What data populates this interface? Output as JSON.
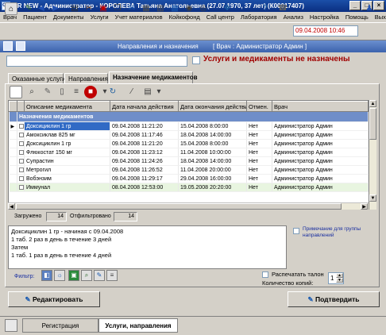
{
  "window": {
    "title": "CR NEW - Администратор - КОРОЛЕВА Татьяна Анатольевна (27.07.1970, 37 лет) (К00017407)",
    "app_icon": "CR",
    "buttons": [
      "_",
      "□",
      "×"
    ]
  },
  "menu": [
    "Врач",
    "Пациент",
    "Документы",
    "Услуги",
    "Учет материалов",
    "Койкофонд",
    "Call центр",
    "Лаборатория",
    "Анализ",
    "Настройка",
    "Помощь",
    "Выход"
  ],
  "toolbar": {
    "datetime": "09.04.2008 10:46"
  },
  "header": {
    "title": "Направления и назначения",
    "doctor": "[ Врач : Администратор Админ ]",
    "warning": "Услуги и медикаменты не назначены"
  },
  "tabs": [
    "Оказанные услуги",
    "Направления",
    "Назначение медикаментов"
  ],
  "grid": {
    "columns": [
      "Описание медикамента",
      "Дата начала действия",
      "Дата окончания действия",
      "Отмен.",
      "Врач"
    ],
    "group": "Назначения медикаментов",
    "rows": [
      {
        "name": "Доксициклин 1 гр",
        "start": "09.04.2008 11:21:20",
        "end": "15.04.2008 8:00:00",
        "cancel": "Нет",
        "doctor": "Администратор Админ"
      },
      {
        "name": "Амоксиклав 825 мг",
        "start": "09.04.2008 11:17:46",
        "end": "18.04.2008 14:00:00",
        "cancel": "Нет",
        "doctor": "Администратор Админ"
      },
      {
        "name": "Доксициклин 1 гр",
        "start": "09.04.2008 11:21:20",
        "end": "15.04.2008 8:00:00",
        "cancel": "Нет",
        "doctor": "Администратор Админ"
      },
      {
        "name": "Флюкостат 150 мг",
        "start": "09.04.2008 11:23:12",
        "end": "11.04.2008 10:00:00",
        "cancel": "Нет",
        "doctor": "Администратор Админ"
      },
      {
        "name": "Супрастин",
        "start": "09.04.2008 11:24:26",
        "end": "18.04.2008 14:00:00",
        "cancel": "Нет",
        "doctor": "Администратор Админ"
      },
      {
        "name": "Метрогил",
        "start": "09.04.2008 11:26:52",
        "end": "11.04.2008 20:00:00",
        "cancel": "Нет",
        "doctor": "Администратор Админ"
      },
      {
        "name": "Вобэнзим",
        "start": "09.04.2008 11:29:17",
        "end": "29.04.2008 16:00:00",
        "cancel": "Нет",
        "doctor": "Администратор Админ"
      },
      {
        "name": "Иммунал",
        "start": "08.04.2008 12:53:00",
        "end": "19.05.2008 20:20:00",
        "cancel": "Нет",
        "doctor": "Администратор Админ"
      }
    ]
  },
  "counts": {
    "loaded_label": "Загружено",
    "loaded": "14",
    "filtered_label": "Отфильтровано",
    "filtered": "14"
  },
  "notes": {
    "lines": [
      "Доксициклин 1 гр - начиная с 09.04.2008",
      "1 таб. 2 раз в день в течение 3 дней",
      "Затем",
      "1 таб. 1 раз в день в течение  4 дней"
    ],
    "group_note": "Примечание для группы направлений"
  },
  "filter": {
    "label": "Фильтр:"
  },
  "print": {
    "label": "Распечатать талон",
    "copies_label": "Количество копий:",
    "copies": "1"
  },
  "actions": {
    "edit": "Редактировать",
    "confirm": "Подтвердить"
  },
  "bottom_tabs": [
    "Регистрация",
    "Услуги, направления"
  ]
}
